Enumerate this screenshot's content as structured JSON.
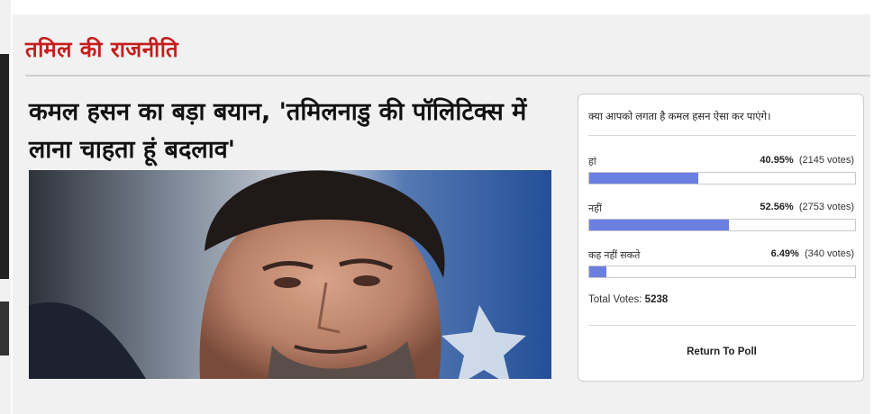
{
  "section": {
    "title": "तमिल की राजनीति"
  },
  "article": {
    "headline": "कमल हसन का बड़ा बयान, 'तमिलनाडु की पॉलिटिक्स में लाना चाहता हूं बदलाव'"
  },
  "poll": {
    "question": "क्या आपको लगता है कमल हसन ऐसा कर पाएंगे।",
    "options": [
      {
        "label": "हां",
        "percent": "40.95%",
        "votes": "(2145 votes)",
        "fill": 0.4095
      },
      {
        "label": "नहीं",
        "percent": "52.56%",
        "votes": "(2753 votes)",
        "fill": 0.5256
      },
      {
        "label": "कह नहीं सकते",
        "percent": "6.49%",
        "votes": "(340 votes)",
        "fill": 0.0649
      }
    ],
    "total_label": "Total Votes:",
    "total_value": "5238",
    "return_label": "Return To Poll",
    "bar_color": "#6b7fe0"
  },
  "colors": {
    "section_title": "#c41e1e",
    "panel_bg": "#f1f1f1"
  }
}
